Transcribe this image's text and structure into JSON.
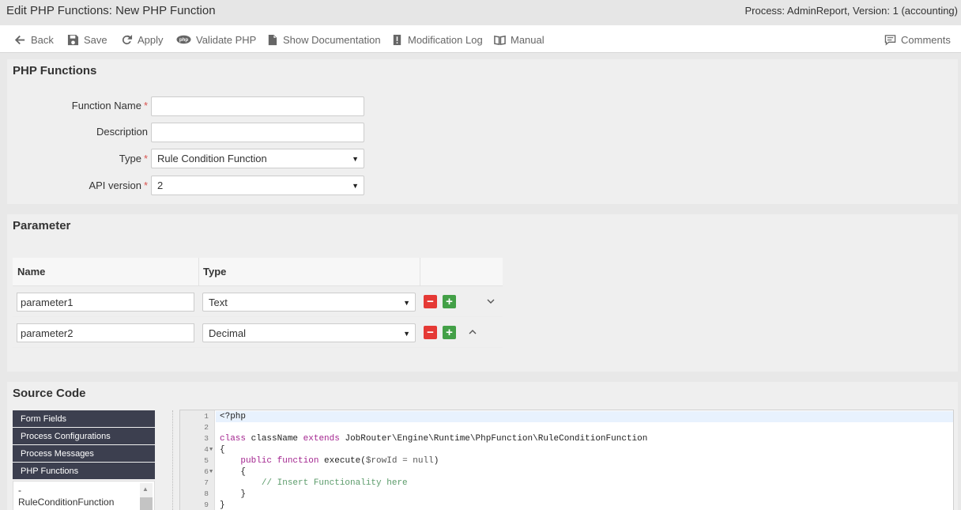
{
  "window": {
    "title": "Edit PHP Functions: New PHP Function",
    "process_info": "Process: AdminReport, Version: 1 (accounting)"
  },
  "toolbar": {
    "back": "Back",
    "save": "Save",
    "apply": "Apply",
    "validate": "Validate PHP",
    "show_doc": "Show Documentation",
    "modlog": "Modification Log",
    "manual": "Manual",
    "comments": "Comments"
  },
  "php_functions": {
    "heading": "PHP Functions",
    "function_name_label": "Function Name",
    "function_name_value": "",
    "description_label": "Description",
    "description_value": "",
    "type_label": "Type",
    "type_value": "Rule Condition Function",
    "api_label": "API version",
    "api_value": "2",
    "required_mark": "*"
  },
  "parameter": {
    "heading": "Parameter",
    "col_name": "Name",
    "col_type": "Type",
    "rows": [
      {
        "name": "parameter1",
        "type": "Text"
      },
      {
        "name": "parameter2",
        "type": "Decimal"
      }
    ],
    "minus": "−",
    "plus": "+"
  },
  "source_code": {
    "heading": "Source Code",
    "nav": [
      "Form Fields",
      "Process Configurations",
      "Process Messages",
      "PHP Functions"
    ],
    "list_items": [
      "-",
      "RuleConditionFunction"
    ],
    "lines": [
      {
        "n": "1",
        "text": "<?php"
      },
      {
        "n": "2",
        "text": ""
      },
      {
        "n": "3",
        "text": "class className extends JobRouter\\Engine\\Runtime\\PhpFunction\\RuleConditionFunction"
      },
      {
        "n": "4",
        "text": "{"
      },
      {
        "n": "5",
        "text": "    public function execute($rowId = null)"
      },
      {
        "n": "6",
        "text": "    {"
      },
      {
        "n": "7",
        "text": "        // Insert Functionality here"
      },
      {
        "n": "8",
        "text": "    }"
      },
      {
        "n": "9",
        "text": "}"
      }
    ],
    "code_parts": {
      "class_kw": "class",
      "class_name": "className",
      "extends_kw": "extends",
      "parent": "JobRouter\\Engine\\Runtime\\PhpFunction\\RuleConditionFunction",
      "public_kw": "public",
      "function_kw": "function",
      "method": "execute(",
      "param": "$rowId = null",
      "close_paren": ")",
      "comment": "// Insert Functionality here"
    }
  },
  "icons": {
    "back": "arrow-left-icon",
    "save": "floppy-icon",
    "apply": "refresh-icon",
    "validate": "php-icon",
    "show_doc": "document-icon",
    "modlog": "exclamation-icon",
    "manual": "book-icon",
    "comments": "comment-icon"
  },
  "colors": {
    "nav_bg": "#3c3f4f",
    "minus_btn": "#e53935",
    "plus_btn": "#43a047",
    "required": "#d9534f",
    "keyword": "#a3258f",
    "comment": "#5b9b6a"
  }
}
